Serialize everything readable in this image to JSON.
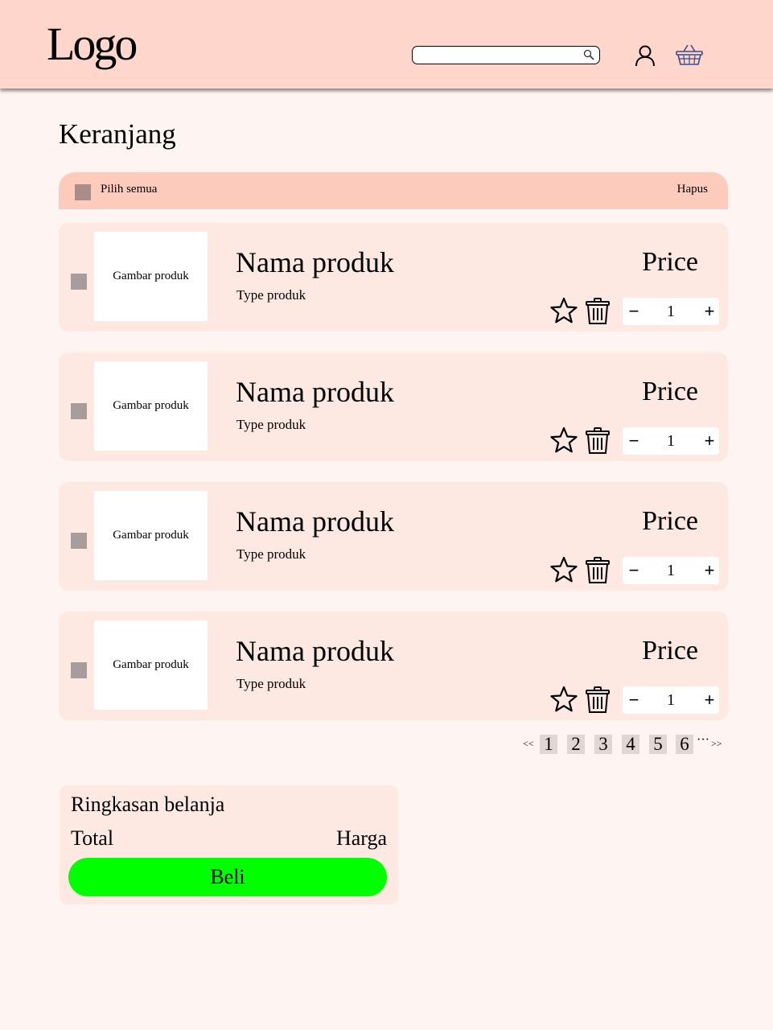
{
  "header": {
    "logo": "Logo",
    "search": {
      "value": "",
      "placeholder": ""
    }
  },
  "page": {
    "title": "Keranjang"
  },
  "select_bar": {
    "select_all_label": "Pilih semua",
    "delete_label": "Hapus"
  },
  "items": [
    {
      "image_label": "Gambar produk",
      "name": "Nama produk",
      "type": "Type produk",
      "price": "Price",
      "quantity": "1"
    },
    {
      "image_label": "Gambar produk",
      "name": "Nama produk",
      "type": "Type produk",
      "price": "Price",
      "quantity": "1"
    },
    {
      "image_label": "Gambar produk",
      "name": "Nama produk",
      "type": "Type produk",
      "price": "Price",
      "quantity": "1"
    },
    {
      "image_label": "Gambar produk",
      "name": "Nama produk",
      "type": "Type produk",
      "price": "Price",
      "quantity": "1"
    }
  ],
  "qty_controls": {
    "minus": "−",
    "plus": "+"
  },
  "pagination": {
    "prev": "<<",
    "pages": [
      "1",
      "2",
      "3",
      "4",
      "5",
      "6"
    ],
    "ellipsis": "···",
    "next": ">>"
  },
  "summary": {
    "title": "Ringkasan belanja",
    "total_label": "Total",
    "total_value": "Harga",
    "buy_label": "Beli"
  },
  "icons": {
    "search": "search-icon",
    "user": "user-icon",
    "basket": "basket-icon",
    "star": "star-icon",
    "trash": "trash-icon"
  },
  "colors": {
    "header_bg": "#fed6cb",
    "page_bg": "#fef4f1",
    "card_bg": "#fde8e2",
    "select_bar_bg": "#fdcbbb",
    "buy_button": "#00ff00",
    "basket_icon": "#3a4a8a"
  }
}
